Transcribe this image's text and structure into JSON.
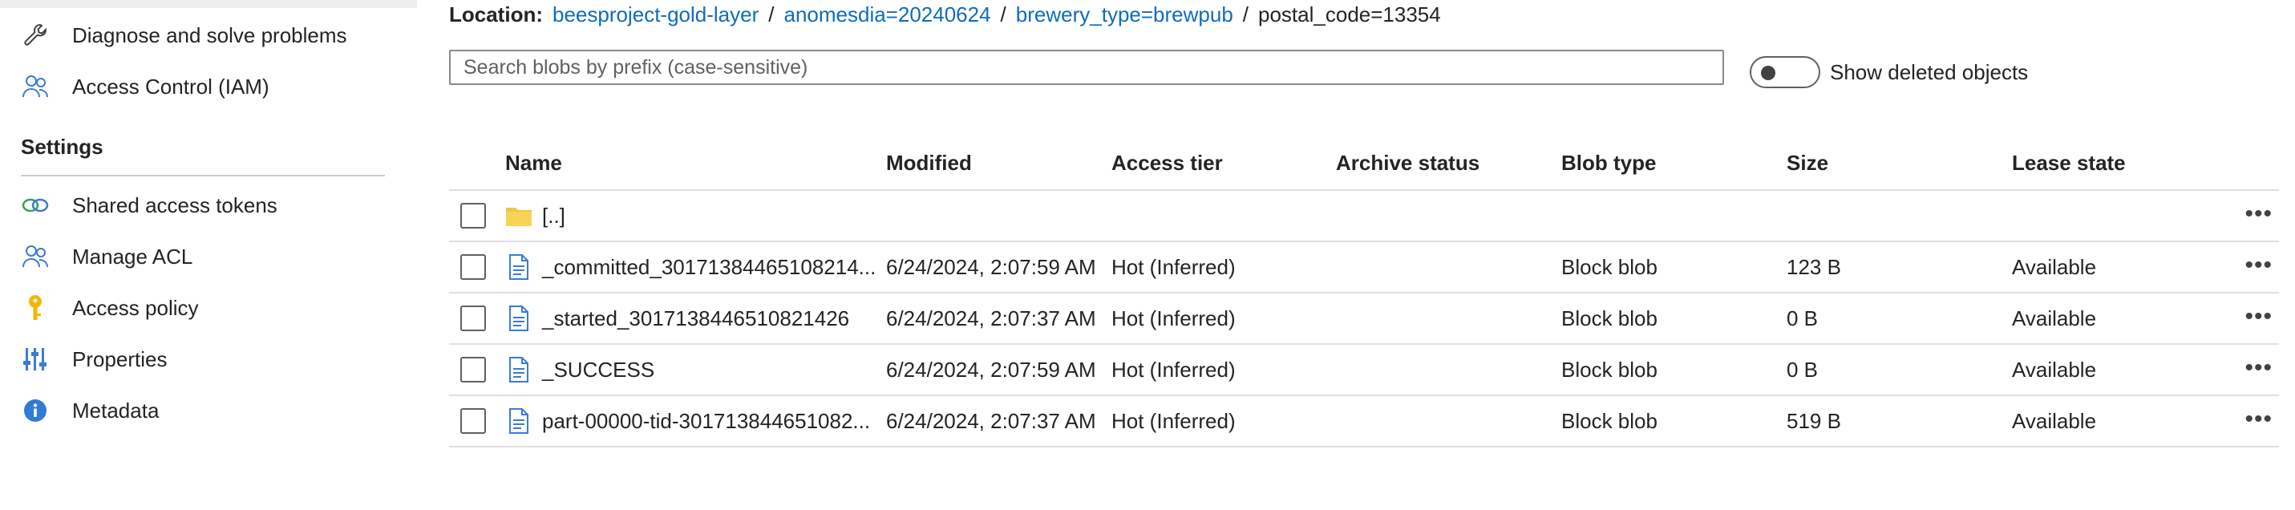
{
  "sidebar": {
    "items_top": [
      {
        "label": "Diagnose and solve problems",
        "icon": "wrench-icon"
      },
      {
        "label": "Access Control (IAM)",
        "icon": "people-icon"
      }
    ],
    "section_title": "Settings",
    "settings_items": [
      {
        "label": "Shared access tokens",
        "icon": "link-chain-icon"
      },
      {
        "label": "Manage ACL",
        "icon": "people-icon"
      },
      {
        "label": "Access policy",
        "icon": "key-icon"
      },
      {
        "label": "Properties",
        "icon": "sliders-icon"
      },
      {
        "label": "Metadata",
        "icon": "info-icon"
      }
    ]
  },
  "location": {
    "label": "Location:",
    "crumbs": [
      "beesproject-gold-layer",
      "anomesdia=20240624",
      "brewery_type=brewpub"
    ],
    "current": "postal_code=13354",
    "separator": "/"
  },
  "search": {
    "placeholder": "Search blobs by prefix (case-sensitive)"
  },
  "toggle": {
    "label": "Show deleted objects",
    "on": false
  },
  "table": {
    "columns": [
      "Name",
      "Modified",
      "Access tier",
      "Archive status",
      "Blob type",
      "Size",
      "Lease state"
    ],
    "rows": [
      {
        "name": "[..]",
        "kind": "folder",
        "modified": "",
        "tier": "",
        "archive": "",
        "type": "",
        "size": "",
        "lease": ""
      },
      {
        "name": "_committed_30171384465108214...",
        "kind": "file",
        "modified": "6/24/2024, 2:07:59 AM",
        "tier": "Hot (Inferred)",
        "archive": "",
        "type": "Block blob",
        "size": "123 B",
        "lease": "Available"
      },
      {
        "name": "_started_3017138446510821426",
        "kind": "file",
        "modified": "6/24/2024, 2:07:37 AM",
        "tier": "Hot (Inferred)",
        "archive": "",
        "type": "Block blob",
        "size": "0 B",
        "lease": "Available"
      },
      {
        "name": "_SUCCESS",
        "kind": "file",
        "modified": "6/24/2024, 2:07:59 AM",
        "tier": "Hot (Inferred)",
        "archive": "",
        "type": "Block blob",
        "size": "0 B",
        "lease": "Available"
      },
      {
        "name": "part-00000-tid-301713844651082...",
        "kind": "file",
        "modified": "6/24/2024, 2:07:37 AM",
        "tier": "Hot (Inferred)",
        "archive": "",
        "type": "Block blob",
        "size": "519 B",
        "lease": "Available"
      }
    ],
    "more_label": "•••"
  },
  "colors": {
    "link": "#0f6cbd",
    "folder": "#f2c744",
    "icon_blue": "#3a7bd5"
  }
}
